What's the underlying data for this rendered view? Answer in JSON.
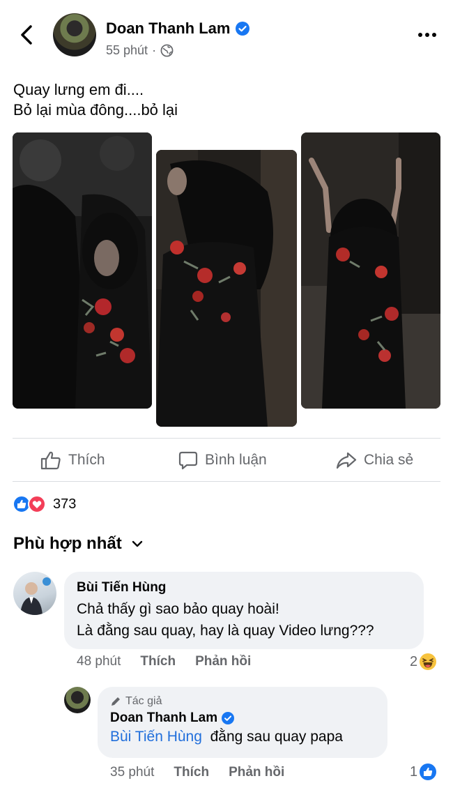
{
  "header": {
    "name": "Doan Thanh Lam",
    "time": "55 phút",
    "separator": "·",
    "icons": {
      "back": "chevron-left-icon",
      "verified": "verified-badge-icon",
      "privacy": "globe-icon",
      "more": "more-dots-icon"
    }
  },
  "post": {
    "caption": "Quay lưng em đi....\nBỏ lại mùa đông....bỏ lại",
    "photos": [
      "photo-1",
      "photo-2",
      "photo-3"
    ]
  },
  "actions": {
    "like": "Thích",
    "comment": "Bình luận",
    "share": "Chia sẻ"
  },
  "reactions": {
    "count": "373",
    "types": [
      "like",
      "love"
    ]
  },
  "comments_sort": {
    "label": "Phù hợp nhất"
  },
  "comments": [
    {
      "name": "Bùi Tiến Hùng",
      "text_line1": "Chả thấy gì sao bảo quay hoài!",
      "text_line2": "Là đằng sau quay, hay là quay Video lưng???",
      "time": "48 phút",
      "like": "Thích",
      "reply": "Phản hồi",
      "reaction_count": "2",
      "reaction_type": "haha"
    },
    {
      "author_tag": "Tác giả",
      "name": "Doan Thanh Lam",
      "mention": "Bùi Tiến Hùng",
      "text": "đằng sau quay papa",
      "time": "35 phút",
      "like": "Thích",
      "reply": "Phản hồi",
      "reaction_count": "1",
      "reaction_type": "like"
    }
  ],
  "colors": {
    "text": "#050505",
    "secondary": "#65676b",
    "link": "#216fdb",
    "like_blue": "#1877f2",
    "love_red": "#f33e58",
    "bubble": "#f0f2f5"
  }
}
